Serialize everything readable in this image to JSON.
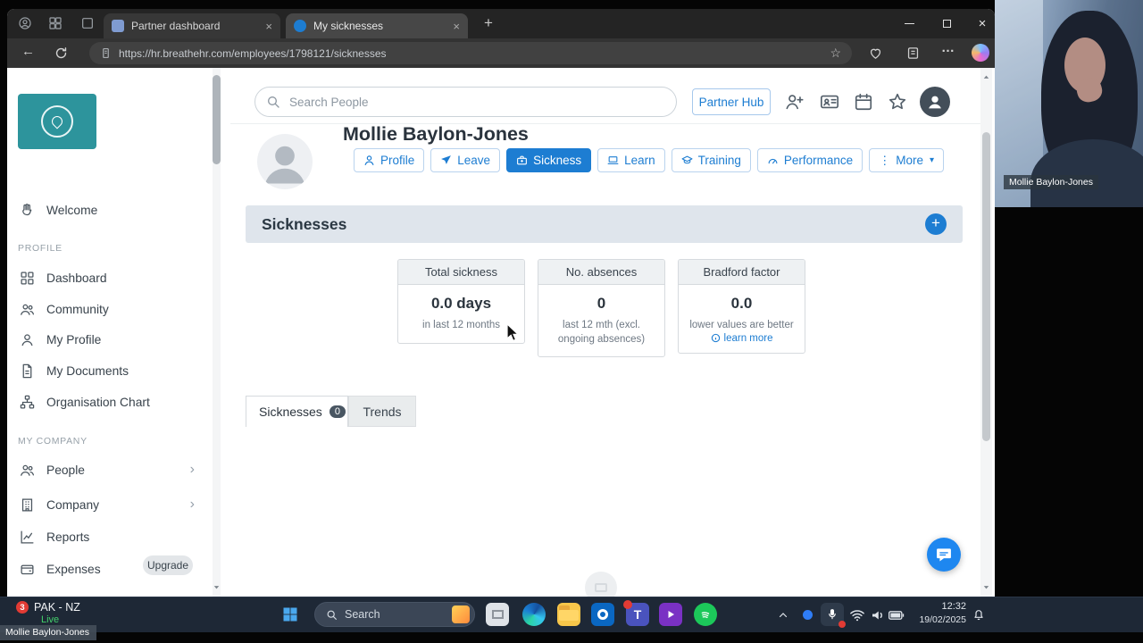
{
  "colors": {
    "accent": "#1d7dd2",
    "logo_teal": "#2d949c",
    "live_green": "#43d06b",
    "badge_red": "#e23b34",
    "chat_blue": "#1e87f0"
  },
  "icons": {
    "back": "←",
    "star": "☆",
    "ellipsis": "…",
    "new_tab": "+",
    "close": "×",
    "chevron_right": "›",
    "caret_down": "▾",
    "more_dots": "⋮",
    "plus": "+"
  },
  "browser": {
    "tabs": [
      {
        "title": "Partner dashboard"
      },
      {
        "title": "My sicknesses"
      }
    ],
    "url": "https://hr.breathehr.com/employees/1798121/sicknesses"
  },
  "sidebar": {
    "welcome": "Welcome",
    "profile_section": "PROFILE",
    "profile_items": [
      "Dashboard",
      "Community",
      "My Profile",
      "My Documents",
      "Organisation Chart"
    ],
    "company_section": "MY COMPANY",
    "company_items": [
      "People",
      "Company",
      "Reports",
      "Expenses"
    ],
    "upgrade_label": "Upgrade"
  },
  "header": {
    "search_placeholder": "Search People",
    "partner_hub_label": "Partner Hub"
  },
  "employee": {
    "name": "Mollie Baylon-Jones",
    "nav": [
      {
        "label": "Profile"
      },
      {
        "label": "Leave"
      },
      {
        "label": "Sickness"
      },
      {
        "label": "Learn"
      },
      {
        "label": "Training"
      },
      {
        "label": "Performance"
      },
      {
        "label": "More"
      }
    ]
  },
  "sickness_section": {
    "title": "Sicknesses"
  },
  "stats": [
    {
      "title": "Total sickness",
      "value": "0.0 days",
      "caption": "in last 12 months"
    },
    {
      "title": "No. absences",
      "value": "0",
      "caption": "last 12 mth (excl. ongoing absences)"
    },
    {
      "title": "Bradford factor",
      "value": "0.0",
      "caption": "lower values are better",
      "link": "learn more"
    }
  ],
  "content_tabs": {
    "sicknesses": "Sicknesses",
    "count": "0",
    "trends": "Trends"
  },
  "taskbar": {
    "search": "Search",
    "time": "12:32",
    "date": "19/02/2025"
  },
  "stream": {
    "badge": "3",
    "title": "PAK - NZ",
    "live": "Live"
  },
  "nametag": "Mollie Baylon-Jones",
  "webcam": {
    "label": "Mollie Baylon-Jones"
  }
}
